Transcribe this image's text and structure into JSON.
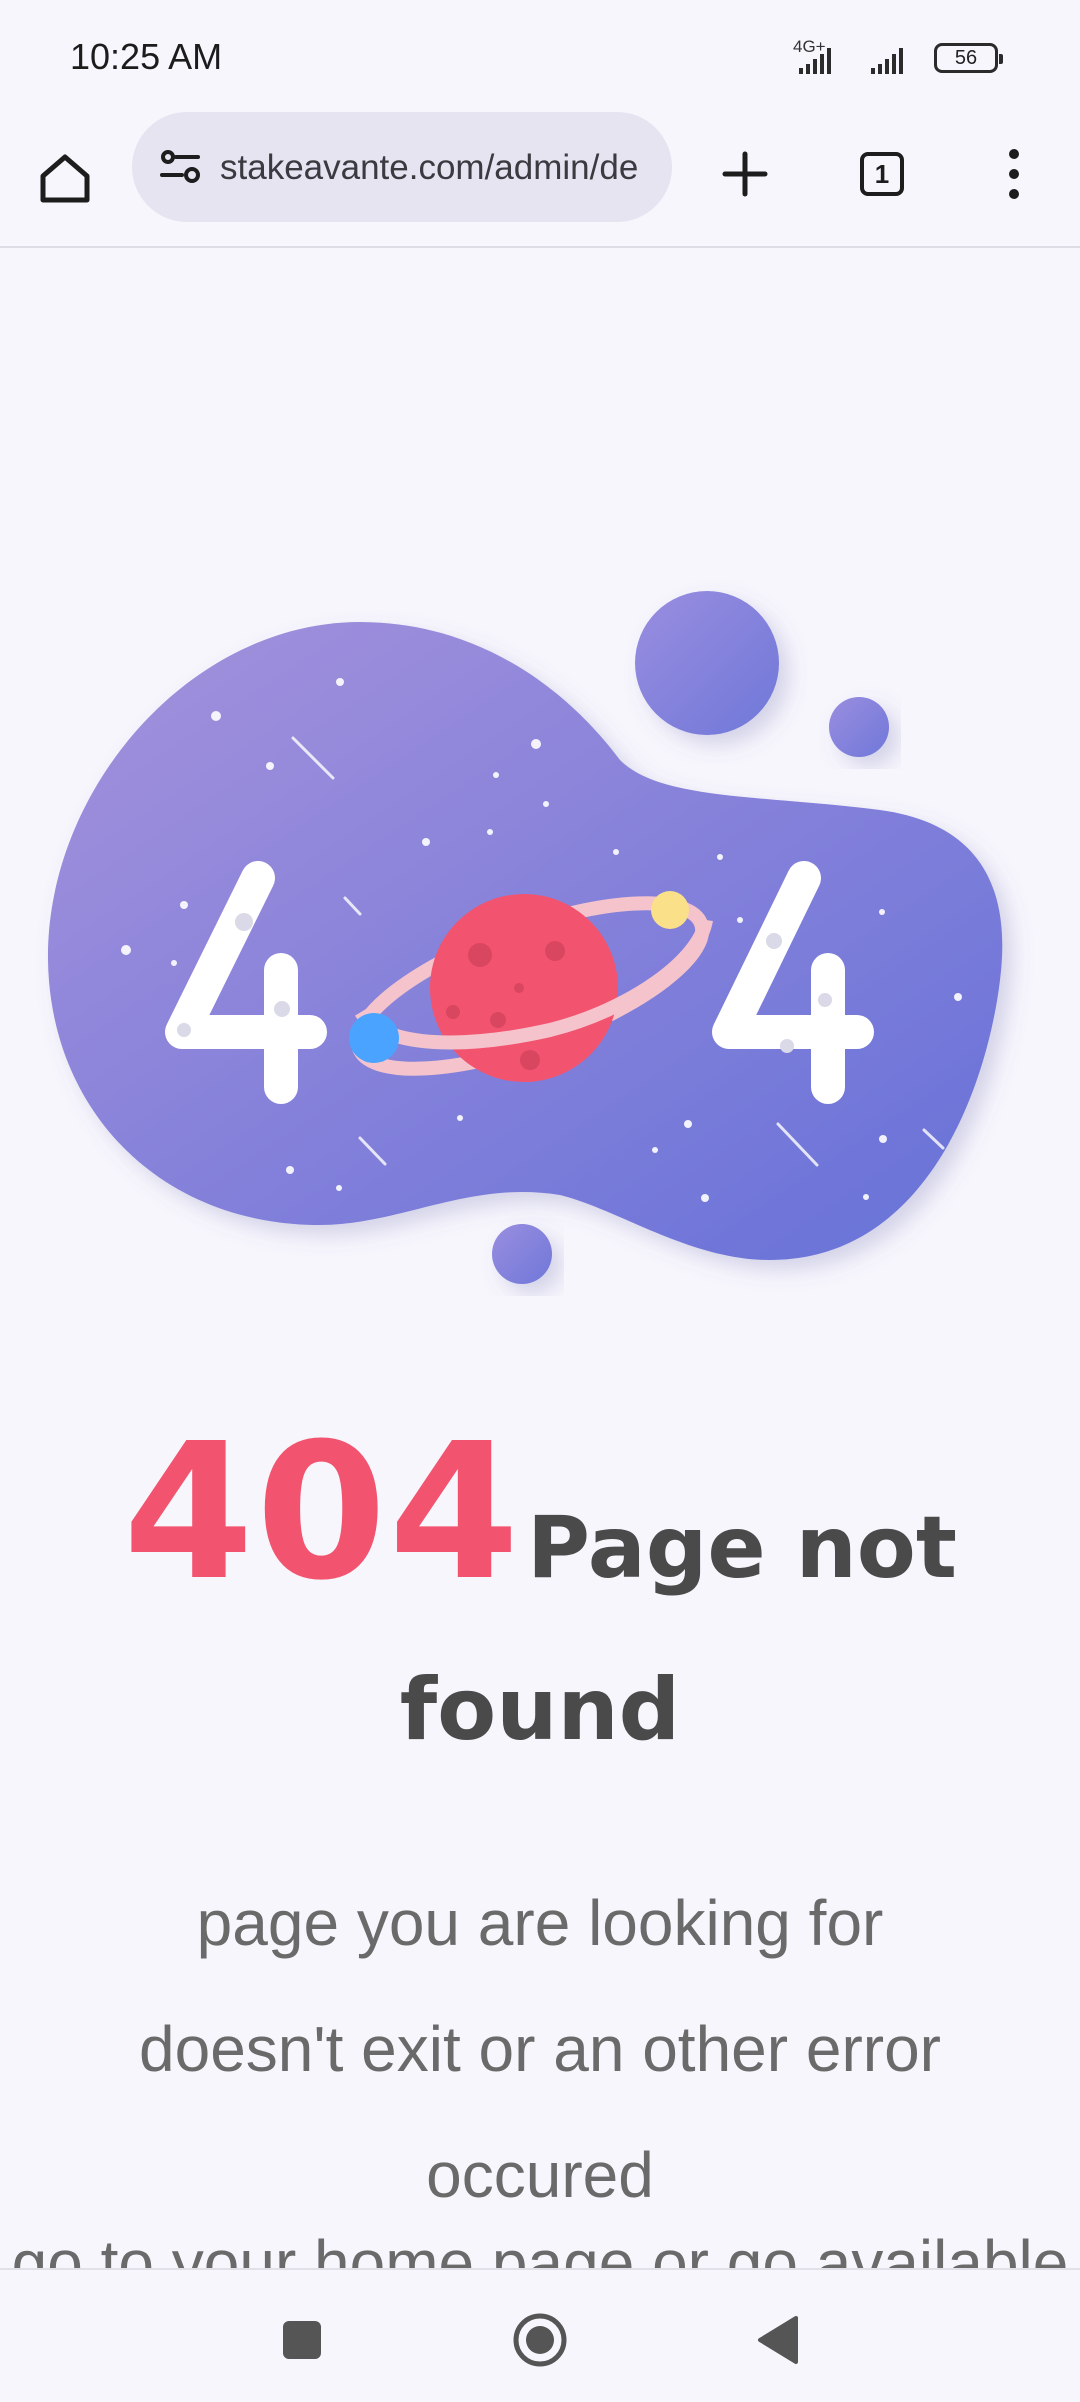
{
  "status_bar": {
    "time": "10:25 AM",
    "network": "4G+",
    "battery": "56"
  },
  "browser": {
    "url": "stakeavante.com/admin/de",
    "tab_count": "1",
    "icons": {
      "home": "home-icon",
      "site_info": "site-settings-icon",
      "new_tab": "plus-icon",
      "tabs": "tab-switcher-icon",
      "menu": "more-vert-icon"
    }
  },
  "error_page": {
    "code": "404",
    "title_part1": "Page not",
    "title_part2": "found",
    "message_lines": [
      "page you are looking for",
      "doesn't exit or an other error",
      "occured"
    ],
    "clipped_line": "go to your home page or go available",
    "colors": {
      "accent": "#f2546f",
      "heading": "#4a4a4a",
      "body": "#6a6a6a",
      "blob_start": "#9f8fdb",
      "blob_end": "#6a73d8",
      "planet": "#f2546f"
    },
    "illustration_digits": [
      "4",
      "4"
    ]
  },
  "nav_bar": {
    "icons": [
      "recents-icon",
      "home-circle-icon",
      "back-icon"
    ]
  }
}
